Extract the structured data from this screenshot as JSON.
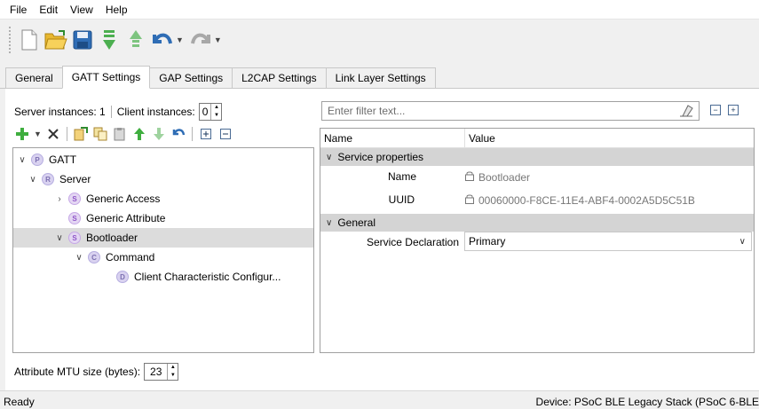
{
  "menu": [
    "File",
    "Edit",
    "View",
    "Help"
  ],
  "tabs": [
    {
      "label": "General",
      "active": false
    },
    {
      "label": "GATT Settings",
      "active": true
    },
    {
      "label": "GAP Settings",
      "active": false
    },
    {
      "label": "L2CAP Settings",
      "active": false
    },
    {
      "label": "Link Layer Settings",
      "active": false
    }
  ],
  "instances": {
    "server_label": "Server instances: 1",
    "client_label": "Client instances:",
    "client_value": "0"
  },
  "tree": {
    "nodes": [
      {
        "label": "GATT",
        "badge": "P",
        "expanded": true,
        "level": 0
      },
      {
        "label": "Server",
        "badge": "R",
        "expanded": true,
        "level": 1
      },
      {
        "label": "Generic Access",
        "badge": "S",
        "expanded": false,
        "level": 2
      },
      {
        "label": "Generic Attribute",
        "badge": "S",
        "level": 2
      },
      {
        "label": "Bootloader",
        "badge": "S",
        "expanded": true,
        "level": 2,
        "selected": true
      },
      {
        "label": "Command",
        "badge": "C",
        "expanded": true,
        "level": 3
      },
      {
        "label": "Client Characteristic Configur...",
        "badge": "D",
        "level": 4
      }
    ]
  },
  "mtu": {
    "label": "Attribute MTU size (bytes):",
    "value": "23"
  },
  "filter": {
    "placeholder": "Enter filter text..."
  },
  "grid": {
    "col_name": "Name",
    "col_value": "Value",
    "sections": [
      {
        "title": "Service properties",
        "rows": [
          {
            "name": "Name",
            "value": "Bootloader"
          },
          {
            "name": "UUID",
            "value": "00060000-F8CE-11E4-ABF4-0002A5D5C51B"
          }
        ]
      },
      {
        "title": "General",
        "rows": [
          {
            "name": "Service Declaration",
            "value": "Primary"
          }
        ]
      }
    ]
  },
  "status": {
    "left": "Ready",
    "right": "Device: PSoC BLE Legacy Stack (PSoC 6-BLE"
  }
}
